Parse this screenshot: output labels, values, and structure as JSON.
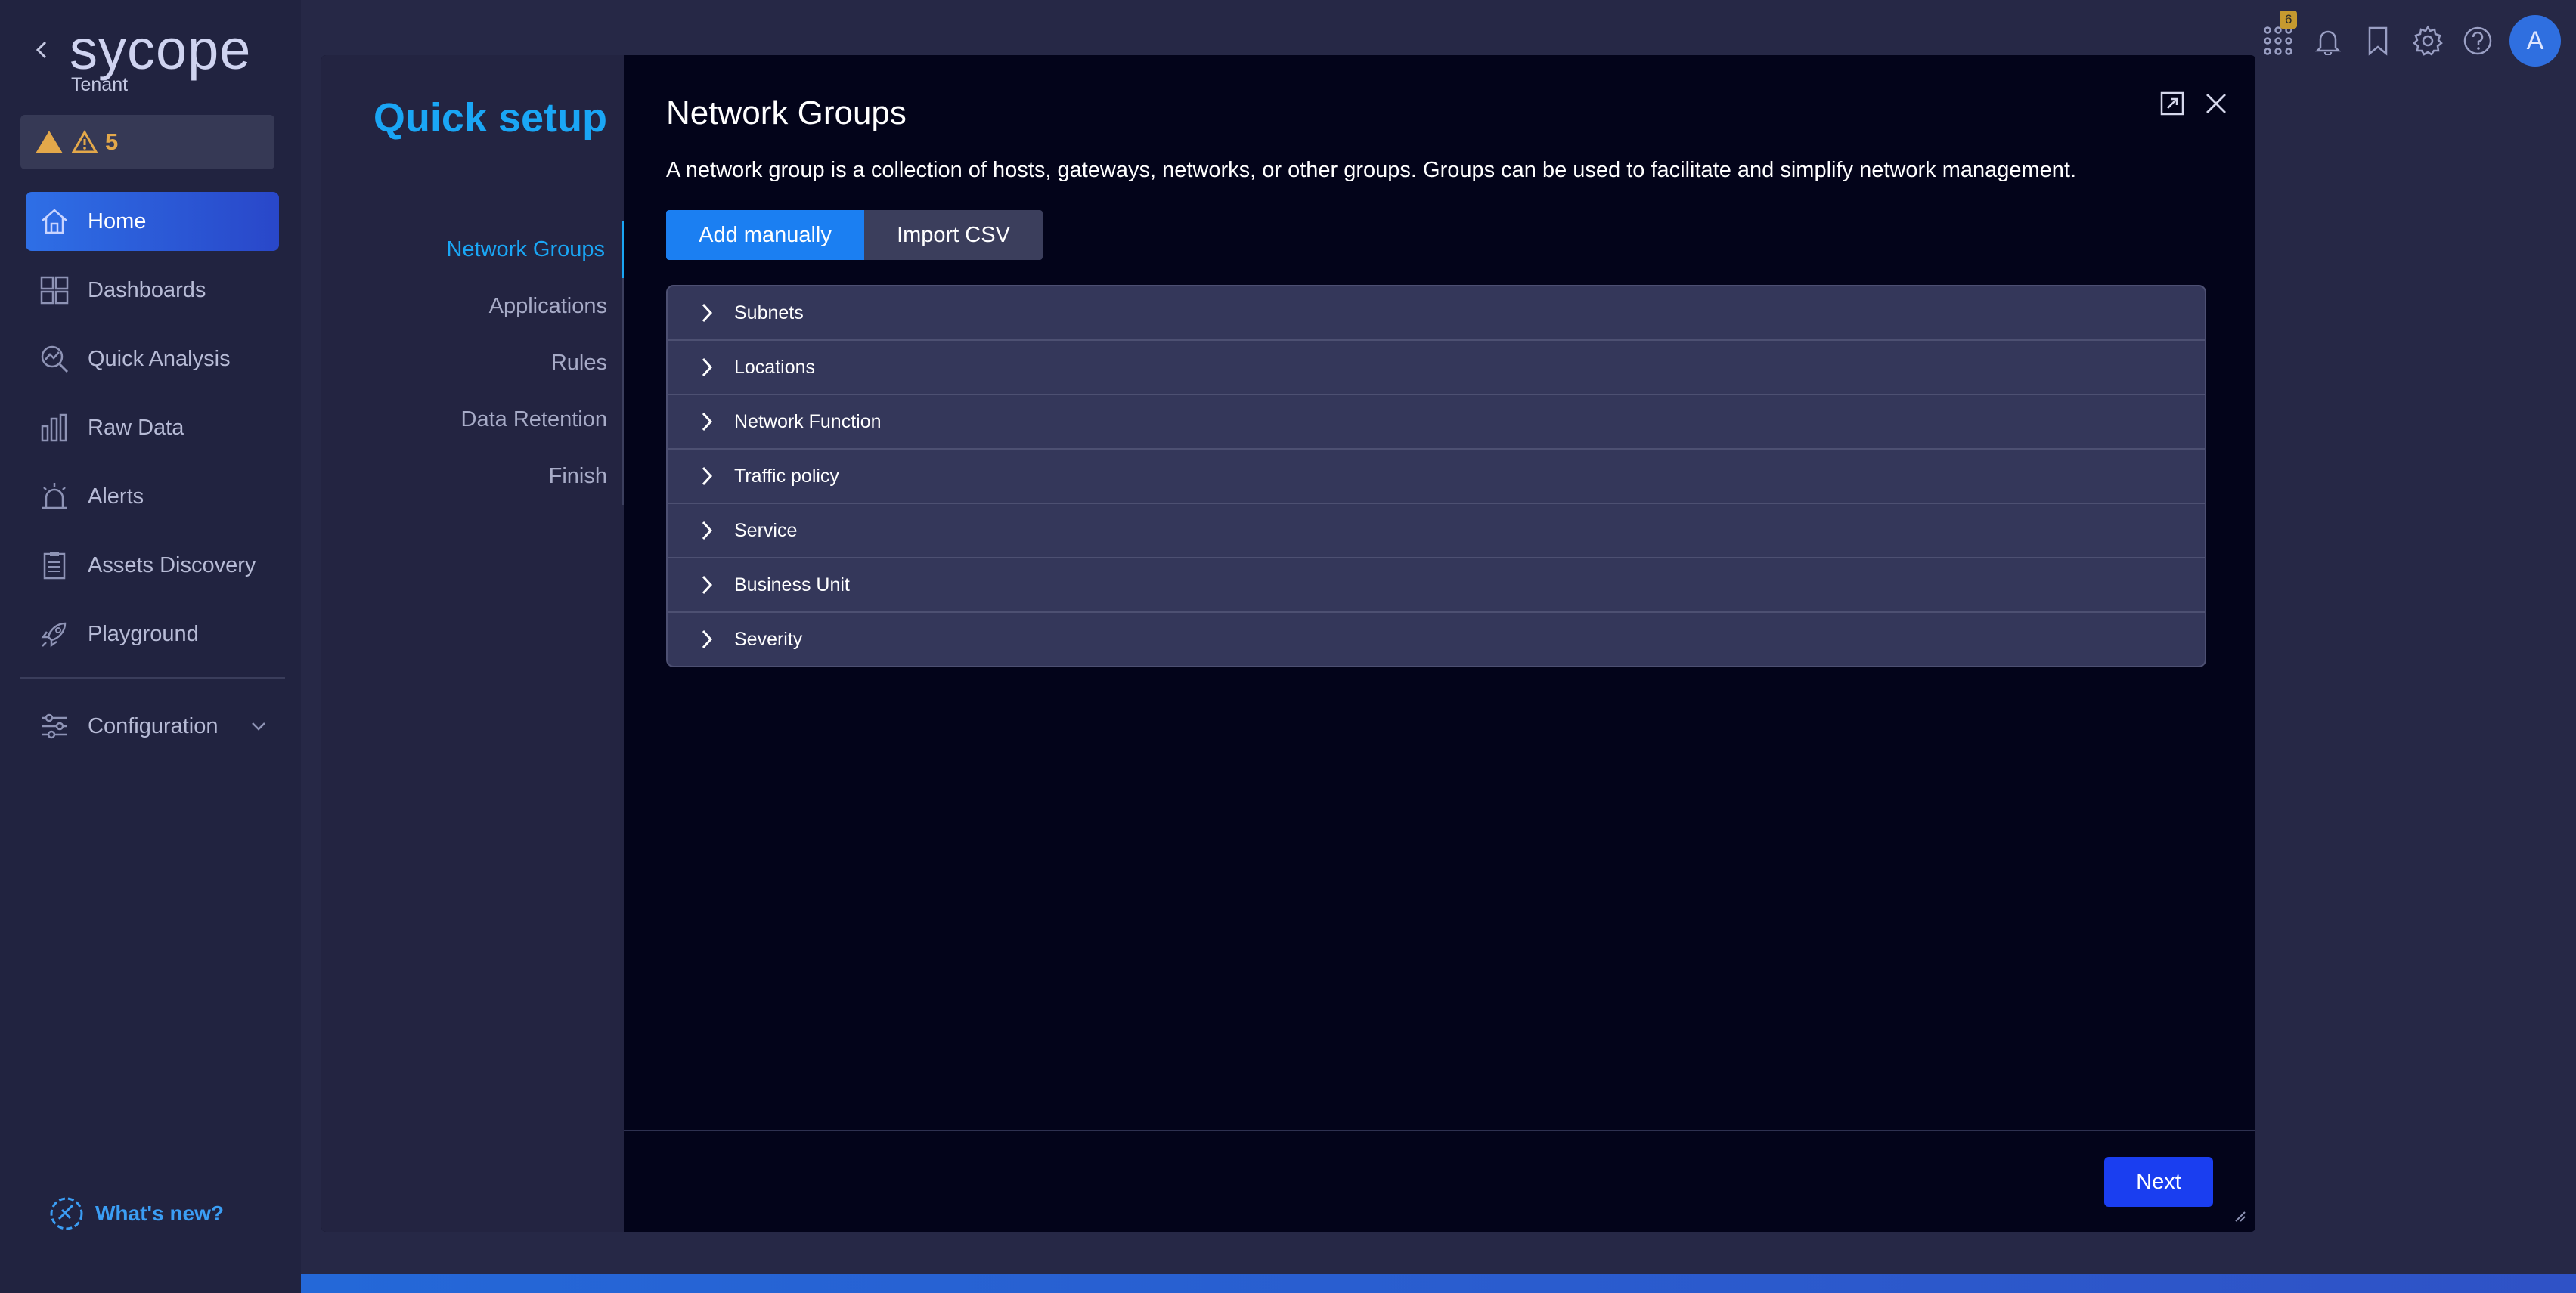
{
  "brand": {
    "logo_text": "sycope",
    "tenant_label": "Tenant"
  },
  "alerts": {
    "count": "5"
  },
  "sidebar": {
    "items": [
      {
        "label": "Home",
        "icon": "home-icon",
        "active": true
      },
      {
        "label": "Dashboards",
        "icon": "dashboards-icon"
      },
      {
        "label": "Quick Analysis",
        "icon": "quick-analysis-icon"
      },
      {
        "label": "Raw Data",
        "icon": "raw-data-icon"
      },
      {
        "label": "Alerts",
        "icon": "alarm-icon"
      },
      {
        "label": "Assets Discovery",
        "icon": "clipboard-icon"
      },
      {
        "label": "Playground",
        "icon": "rocket-icon"
      }
    ],
    "configuration": "Configuration",
    "whats_new": "What's new?"
  },
  "topbar": {
    "notification_badge": "6",
    "avatar_initial": "A"
  },
  "dialog": {
    "quick_setup_title": "Quick setup",
    "steps": [
      "Network Groups",
      "Applications",
      "Rules",
      "Data Retention",
      "Finish"
    ],
    "title": "Network Groups",
    "description": "A network group is a collection of hosts, gateways, networks, or other groups. Groups can be used to facilitate and simplify network management.",
    "add_manually": "Add manually",
    "import_csv": "Import CSV",
    "groups": [
      "Subnets",
      "Locations",
      "Network Function",
      "Traffic policy",
      "Service",
      "Business Unit",
      "Severity"
    ],
    "next": "Next"
  },
  "colors": {
    "accent": "#1aa6f5",
    "primary_button": "#1a3ef0",
    "warning": "#e3a84a"
  }
}
